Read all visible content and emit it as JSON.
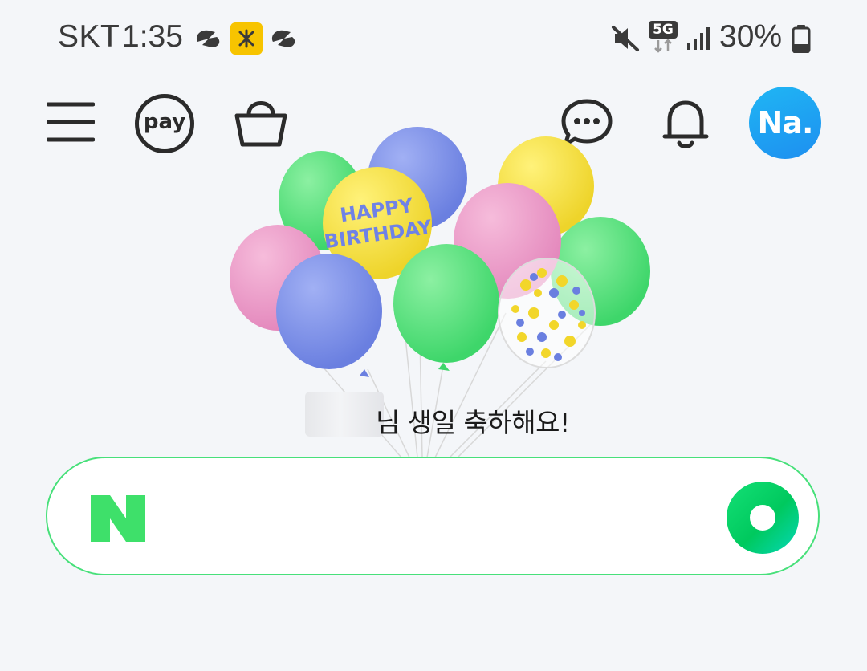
{
  "status_bar": {
    "carrier": "SKT",
    "time": "1:35",
    "network_type": "5G",
    "battery_percent": "30%",
    "icons": [
      "link-icon",
      "kb-bank-app-icon",
      "link-icon",
      "mute-icon",
      "network-5g-icon",
      "signal-icon",
      "battery-icon"
    ]
  },
  "nav": {
    "menu_icon": "hamburger-menu-icon",
    "pay_label": "pay",
    "shopping_icon": "shopping-basket-icon",
    "chat_icon": "chat-bubble-icon",
    "bell_icon": "bell-icon",
    "avatar_label": "Na."
  },
  "hero": {
    "balloon_text": "HAPPY BIRTHDAY",
    "greeting": "님 생일 축하해요!"
  },
  "search": {
    "logo": "N",
    "value": "",
    "placeholder": "",
    "action_icon": "green-dot-icon"
  },
  "colors": {
    "background": "#f4f6f9",
    "naver_green": "#03c75a",
    "search_border": "#47e07a",
    "avatar_blue": "#1e8ff0",
    "balloon_green": "#5ee27d",
    "balloon_blue": "#7b8ee8",
    "balloon_pink": "#ec9cc8",
    "balloon_yellow": "#f6df3a"
  }
}
